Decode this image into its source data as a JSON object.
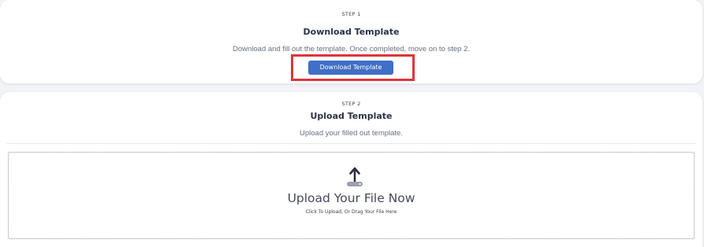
{
  "step1": {
    "label": "STEP 1",
    "title": "Download Template",
    "description": "Download and fill out the template. Once completed, move on to step 2.",
    "button_label": "Download Template"
  },
  "step2": {
    "label": "STEP 2",
    "title": "Upload Template",
    "description": "Upload your filled out template.",
    "dropzone": {
      "icon": "upload-icon",
      "title": "Upload Your File Now",
      "subtitle": "Click To Upload, Or Drag Your File Here"
    }
  },
  "colors": {
    "primary_button": "#3f6fc6",
    "highlight": "#e0343a",
    "background": "#f2f3f7"
  }
}
